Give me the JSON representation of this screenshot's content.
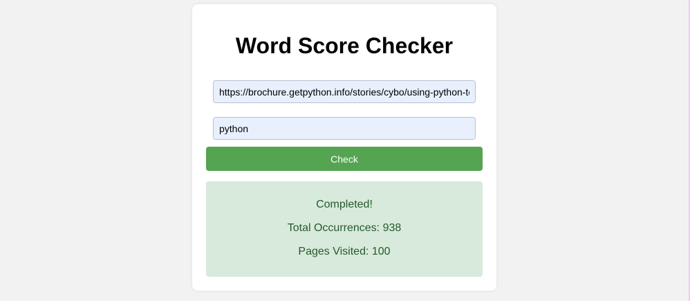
{
  "page": {
    "title": "Word Score Checker"
  },
  "form": {
    "url_value": "https://brochure.getpython.info/stories/cybo/using-python-to-search",
    "word_value": "python",
    "check_label": "Check"
  },
  "result": {
    "status": "Completed!",
    "total_occurrences": "Total Occurrences: 938",
    "pages_visited": "Pages Visited: 100"
  },
  "colors": {
    "background": "#f3f2f3",
    "button": "#54a451",
    "result_background": "#d8eadb",
    "result_text": "#255a2d",
    "input_background": "#e8f0fe"
  }
}
